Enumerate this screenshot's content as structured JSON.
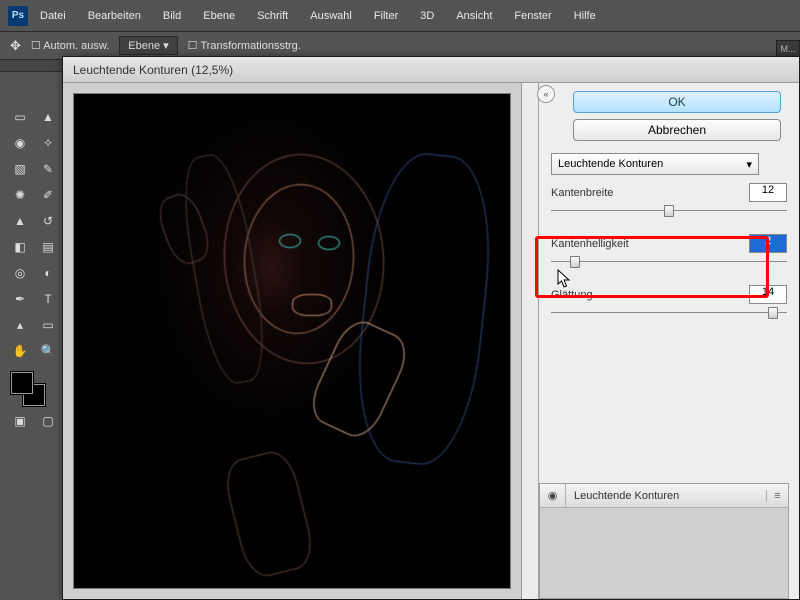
{
  "app": {
    "logo": "Ps"
  },
  "menubar": [
    "Datei",
    "Bearbeiten",
    "Bild",
    "Ebene",
    "Schrift",
    "Auswahl",
    "Filter",
    "3D",
    "Ansicht",
    "Fenster",
    "Hilfe"
  ],
  "optbar": {
    "auto": "Autom. ausw.",
    "mode": "Ebene",
    "transform": "Transformationsstrg."
  },
  "doc": {
    "title": "Leuchtende Konturen (12,5%)"
  },
  "dialog": {
    "ok": "OK",
    "cancel": "Abbrechen",
    "filter_name": "Leuchtende Konturen",
    "params": {
      "p1": {
        "label": "Kantenbreite",
        "value": "12",
        "thumb": 48
      },
      "p2": {
        "label": "Kantenhelligkeit",
        "value": "2",
        "thumb": 8
      },
      "p3": {
        "label": "Glättung",
        "value": "14",
        "thumb": 92
      }
    }
  },
  "layers": {
    "item": "Leuchtende Konturen"
  },
  "moretab": "M...",
  "colors": {
    "highlight": "#ff0000"
  }
}
